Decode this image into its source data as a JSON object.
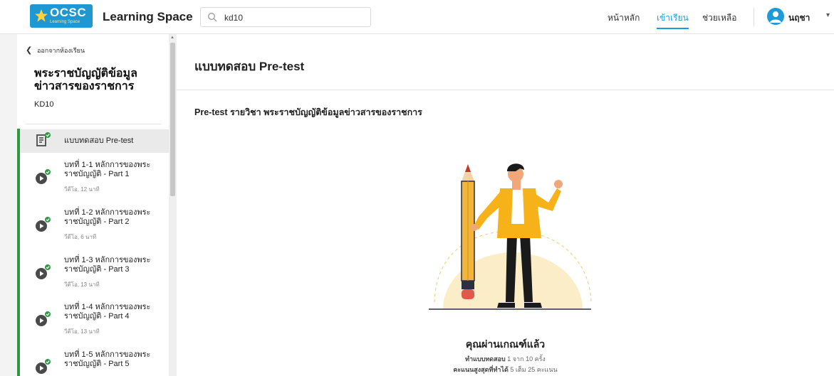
{
  "header": {
    "logo_text": "OCSC",
    "logo_subtext": "Learning Space",
    "brand": "Learning Space",
    "search_value": "kd10",
    "nav": [
      {
        "label": "หน้าหลัก",
        "active": false
      },
      {
        "label": "เข้าเรียน",
        "active": true
      },
      {
        "label": "ช่วยเหลือ",
        "active": false
      }
    ],
    "user_name": "นฤชา"
  },
  "sidebar": {
    "back_label": "ออกจากห้องเรียน",
    "course_title": "พระราชบัญญัติข้อมูลข่าวสารของราชการ",
    "course_code": "KD10",
    "items": [
      {
        "label": "แบบทดสอบ Pre-test",
        "meta": "",
        "type": "quiz",
        "done": true,
        "active": true
      },
      {
        "label": "บทที่ 1-1 หลักการของพระราชบัญญัติ - Part 1",
        "meta": "วีดีโอ, 12 นาที",
        "type": "video",
        "done": true
      },
      {
        "label": "บทที่ 1-2 หลักการของพระราชบัญญัติ - Part 2",
        "meta": "วีดีโอ, 6 นาที",
        "type": "video",
        "done": true
      },
      {
        "label": "บทที่ 1-3 หลักการของพระราชบัญญัติ - Part 3",
        "meta": "วีดีโอ, 13 นาที",
        "type": "video",
        "done": true
      },
      {
        "label": "บทที่ 1-4 หลักการของพระราชบัญญัติ - Part 4",
        "meta": "วีดีโอ, 13 นาที",
        "type": "video",
        "done": true
      },
      {
        "label": "บทที่ 1-5 หลักการของพระราชบัญญัติ - Part 5",
        "meta": "",
        "type": "video",
        "done": true
      }
    ]
  },
  "main": {
    "title": "แบบทดสอบ Pre-test",
    "subtitle": "Pre-test รายวิชา พระราชบัญญัติข้อมูลข่าวสารของราชการ",
    "pass_text": "คุณผ่านเกณฑ์แล้ว",
    "attempt_label": "ทำแบบทดสอบ",
    "attempt_value": "1 จาก 10 ครั้ง",
    "score_label": "คะแนนสูงสุดที่ทำได้",
    "score_value": "5 เต็ม 25 คะแนน"
  },
  "colors": {
    "accent": "#1d9ad7",
    "done": "#2e9943",
    "icon": "#4a4a4a",
    "pencil": "#f0b53a",
    "jacket": "#f7b21a"
  }
}
